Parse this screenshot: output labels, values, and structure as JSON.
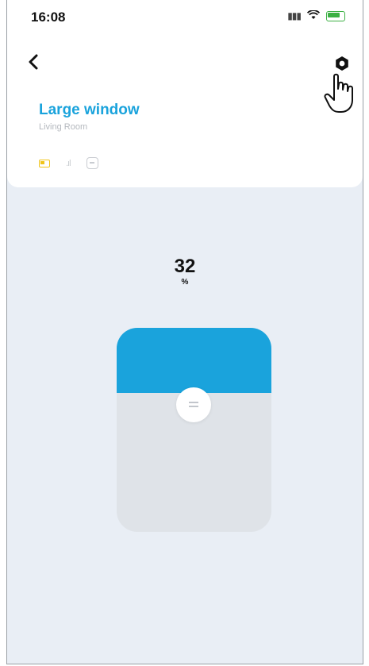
{
  "status_bar": {
    "time": "16:08"
  },
  "header": {
    "back_icon": "chevron-left-icon",
    "settings_icon": "gear-icon"
  },
  "device": {
    "title": "Large window",
    "room": "Living Room"
  },
  "status_icons": [
    "battery-icon",
    "signal-icon",
    "mode-icon"
  ],
  "level": {
    "value": "32",
    "unit": "%",
    "percent": 32
  },
  "colors": {
    "accent": "#1aa3dc",
    "battery": "#f0c419",
    "background": "#e9eef5"
  }
}
